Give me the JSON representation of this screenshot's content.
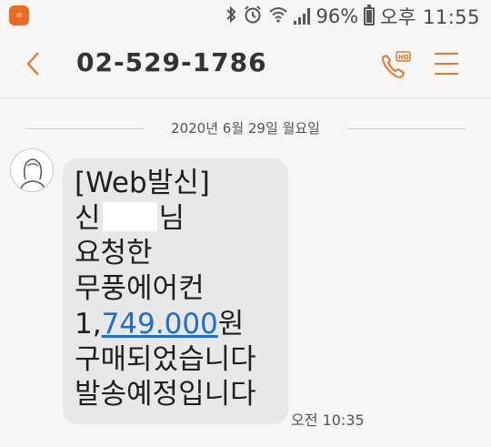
{
  "statusbar": {
    "app_icon": "messages-app-icon",
    "icons": [
      "bluetooth-icon",
      "alarm-icon",
      "wifi-icon",
      "signal-icon"
    ],
    "battery": "96%",
    "time": "오후 11:55"
  },
  "header": {
    "back_icon": "chevron-left-icon",
    "title": "02-529-1786",
    "call_icon": "hd-call-icon",
    "menu_icon": "hamburger-menu-icon",
    "accent": "#e07a2d"
  },
  "conversation": {
    "date": "2020년 6월 29일 월요일",
    "message": {
      "line1": "[Web발신]",
      "line2_prefix": "신",
      "line2_suffix": "님",
      "line3": "요청한",
      "line4": "무풍에어컨",
      "line5_prefix": "1,",
      "line5_amount": "749.000",
      "line5_suffix": "원",
      "line6": "구매되었습니다",
      "line7": "발송예정입니다",
      "time": "오전 10:35"
    }
  }
}
